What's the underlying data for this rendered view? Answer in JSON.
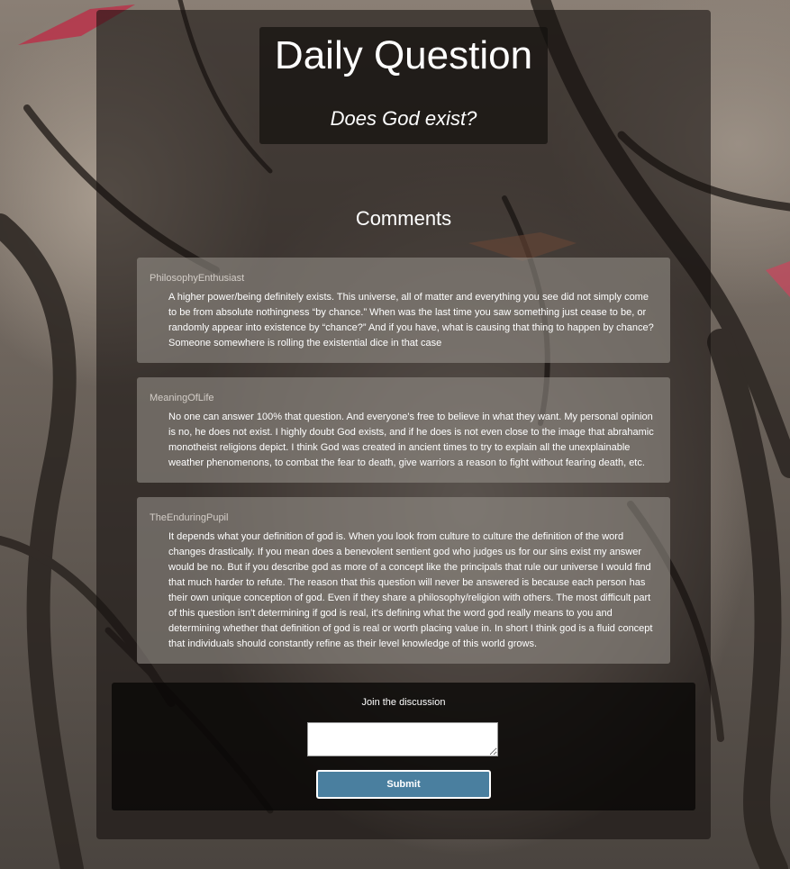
{
  "header": {
    "title": "Daily Question",
    "question": "Does God exist?"
  },
  "comments_section": {
    "heading": "Comments",
    "items": [
      {
        "author": "PhilosophyEnthusiast",
        "text": "A higher power/being definitely exists. This universe, all of matter and everything you see did not simply come to be from absolute nothingness “by chance.” When was the last time you saw something just cease to be, or randomly appear into existence by “chance?” And if you have, what is causing that thing to happen by chance? Someone somewhere is rolling the existential dice in that case"
      },
      {
        "author": "MeaningOfLife",
        "text": "No one can answer 100% that question. And everyone's free to believe in what they want. My personal opinion is no, he does not exist. I highly doubt God exists, and if he does is not even close to the image that abrahamic monotheist religions depict. I think God was created in ancient times to try to explain all the unexplainable weather phenomenons, to combat the fear to death, give warriors a reason to fight without fearing death, etc."
      },
      {
        "author": "TheEnduringPupil",
        "text": "It depends what your definition of god is. When you look from culture to culture the definition of the word changes drastically. If you mean does a benevolent sentient god who judges us for our sins exist my answer would be no. But if you describe god as more of a concept like the principals that rule our universe I would find that much harder to refute. The reason that this question will never be answered is because each person has their own unique conception of god. Even if they share a philosophy/religion with others. The most difficult part of this question isn't determining if god is real, it's defining what the word god really means to you and determining whether that definition of god is real or worth placing value in. In short I think god is a fluid concept that individuals should constantly refine as their level knowledge of this world grows."
      }
    ]
  },
  "discussion": {
    "label": "Join the discussion",
    "input_value": "",
    "submit_label": "Submit"
  },
  "colors": {
    "submit_button": "#4a7f9f",
    "panel_overlay": "#14100e"
  }
}
